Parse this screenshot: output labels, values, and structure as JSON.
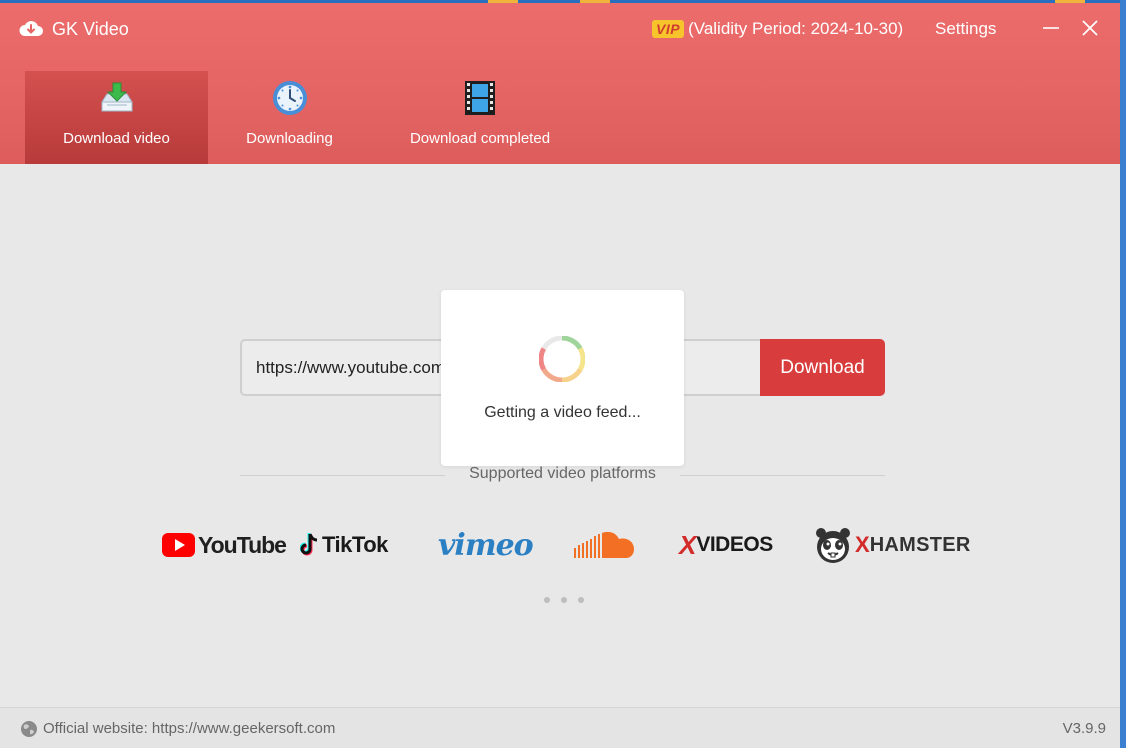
{
  "app": {
    "title": "GK Video"
  },
  "titlebar": {
    "vip_badge": "VIP",
    "validity": "(Validity Period: 2024-10-30)",
    "settings_label": "Settings"
  },
  "tabs": [
    {
      "label": "Download video",
      "icon": "download-tray-icon",
      "active": true
    },
    {
      "label": "Downloading",
      "icon": "clock-icon",
      "active": false
    },
    {
      "label": "Download completed",
      "icon": "film-icon",
      "active": false
    }
  ],
  "search": {
    "url_value": "https://www.youtube.com/",
    "button_label": "Download"
  },
  "loading": {
    "message": "Getting a video feed..."
  },
  "platforms": {
    "heading": "Supported video platforms",
    "items": [
      {
        "name": "YouTube",
        "icon": "youtube-logo",
        "text": "YouTube"
      },
      {
        "name": "TikTok",
        "icon": "tiktok-logo",
        "text": "TikTok"
      },
      {
        "name": "Vimeo",
        "icon": "vimeo-logo",
        "text": "vimeo"
      },
      {
        "name": "SoundCloud",
        "icon": "soundcloud-logo",
        "text": ""
      },
      {
        "name": "XVideos",
        "icon": "xvideos-logo",
        "x": "X",
        "rest": "VIDEOS"
      },
      {
        "name": "xHamster",
        "icon": "xhamster-logo",
        "x": "X",
        "rest": "HAMSTER"
      }
    ]
  },
  "footer": {
    "website": "Official website: https://www.geekersoft.com",
    "version": "V3.9.9"
  },
  "colors": {
    "header": "#e56565",
    "active_tab": "#c44444",
    "download_button": "#d83c3c",
    "vip_badge": "#f7c52b",
    "background": "#e8e8e8"
  }
}
